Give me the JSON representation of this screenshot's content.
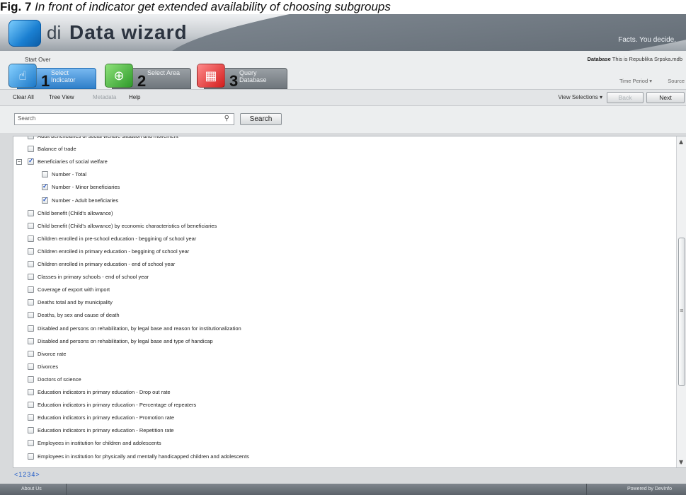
{
  "caption": {
    "prefix": "Fig. 7",
    "rest": " In front of indicator get extended availability of choosing subgroups"
  },
  "header": {
    "logo_di": "di",
    "logo_name": "Data wizard",
    "tagline": "Facts. You decide."
  },
  "steps_bar": {
    "start_over": "Start Over",
    "database_label": "Database",
    "database_value": "This is Republika Srpska.mdb",
    "steps": [
      {
        "num": "1",
        "label": "Select Indicator"
      },
      {
        "num": "2",
        "label": "Select Area"
      },
      {
        "num": "3",
        "label": "Query Database"
      }
    ],
    "time_period": "Time Period",
    "source": "Source"
  },
  "toolbar": {
    "clear_all": "Clear All",
    "tree_view": "Tree View",
    "metadata": "Metadata",
    "help": "Help",
    "view_selections": "View Selections",
    "back": "Back",
    "next": "Next"
  },
  "search": {
    "placeholder": "Search",
    "button": "Search"
  },
  "list": {
    "rows": [
      {
        "label": "Adult beneficiaries of social welfare situation and movement",
        "checked": false,
        "level": 0
      },
      {
        "label": "Balance of trade",
        "checked": false,
        "level": 0
      },
      {
        "label": "Beneficiaries of social welfare",
        "checked": true,
        "level": 0,
        "expanded": true
      },
      {
        "label": "Number - Total",
        "checked": false,
        "level": 1
      },
      {
        "label": "Number - Minor beneficiaries",
        "checked": true,
        "level": 1
      },
      {
        "label": "Number - Adult beneficiaries",
        "checked": true,
        "level": 1
      },
      {
        "label": "Child benefit (Child's allowance)",
        "checked": false,
        "level": 0
      },
      {
        "label": "Child benefit (Child's allowance) by economic characteristics of beneficiaries",
        "checked": false,
        "level": 0
      },
      {
        "label": "Children enrolled in pre-school education - beggining of school year",
        "checked": false,
        "level": 0
      },
      {
        "label": "Children enrolled in primary education - beggining of school year",
        "checked": false,
        "level": 0
      },
      {
        "label": "Children enrolled in primary education - end of school year",
        "checked": false,
        "level": 0
      },
      {
        "label": "Classes in primary schools - end of school year",
        "checked": false,
        "level": 0
      },
      {
        "label": "Coverage of export with import",
        "checked": false,
        "level": 0
      },
      {
        "label": "Deaths total and by municipality",
        "checked": false,
        "level": 0
      },
      {
        "label": "Deaths, by sex and cause of death",
        "checked": false,
        "level": 0
      },
      {
        "label": "Disabled and persons on rehabilitation, by legal base and reason for institutionalization",
        "checked": false,
        "level": 0
      },
      {
        "label": "Disabled and persons on rehabilitation, by legal base and type of handicap",
        "checked": false,
        "level": 0
      },
      {
        "label": "Divorce rate",
        "checked": false,
        "level": 0
      },
      {
        "label": "Divorces",
        "checked": false,
        "level": 0
      },
      {
        "label": "Doctors of science",
        "checked": false,
        "level": 0
      },
      {
        "label": "Education indicators in primary education - Drop out rate",
        "checked": false,
        "level": 0
      },
      {
        "label": "Education indicators in primary education - Percentage of repeaters",
        "checked": false,
        "level": 0
      },
      {
        "label": "Education indicators in primary education - Promotion rate",
        "checked": false,
        "level": 0
      },
      {
        "label": "Education indicators in primary education - Repetition rate",
        "checked": false,
        "level": 0
      },
      {
        "label": "Employees in institution for children and adolescents",
        "checked": false,
        "level": 0
      },
      {
        "label": "Employees in institution for physically and mentally handicapped children and adolescents",
        "checked": false,
        "level": 0
      }
    ]
  },
  "pager": {
    "prev": "<",
    "pages": [
      "1",
      "2",
      "3",
      "4"
    ],
    "next": ">"
  },
  "footer": {
    "left": "About Us",
    "right": "Powered by DevInfo"
  }
}
